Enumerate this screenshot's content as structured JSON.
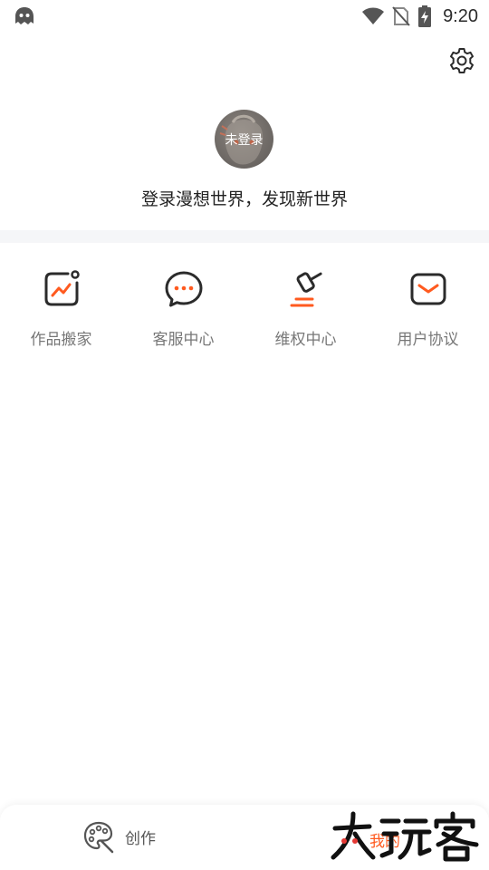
{
  "status_bar": {
    "time": "9:20",
    "icons": [
      "app-ghost-icon",
      "wifi-icon",
      "no-sim-icon",
      "battery-charging-icon"
    ]
  },
  "header": {
    "settings_icon": "gear-icon"
  },
  "profile": {
    "avatar_label": "未登录",
    "slogan": "登录漫想世界，发现新世界"
  },
  "shortcuts": [
    {
      "label": "作品搬家",
      "icon": "trend-card-icon"
    },
    {
      "label": "客服中心",
      "icon": "chat-bubble-icon"
    },
    {
      "label": "维权中心",
      "icon": "gavel-icon"
    },
    {
      "label": "用户协议",
      "icon": "envelope-icon"
    }
  ],
  "bottom_nav": {
    "create_label": "创作",
    "create_icon": "palette-icon",
    "mine_label": "我的"
  },
  "watermark": {
    "text": "大玩客"
  },
  "colors": {
    "accent": "#ff5a1f",
    "icon_dark": "#2b2b2b",
    "label_gray": "#777777",
    "divider": "#f5f6f8"
  }
}
